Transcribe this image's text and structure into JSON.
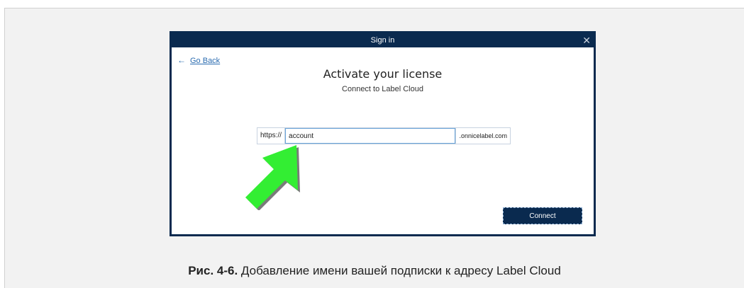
{
  "window": {
    "title": "Sign in",
    "close_glyph": "✕",
    "go_back_label": "Go Back",
    "heading": "Activate your license",
    "subheading": "Connect to Label Cloud",
    "url": {
      "prefix": "https://",
      "value": "account",
      "suffix": ".onnicelabel.com"
    },
    "connect_label": "Connect"
  },
  "caption": {
    "label": "Рис. 4-6.",
    "text": " Добавление имени вашей подписки к адресу Label Cloud"
  },
  "colors": {
    "titlebar": "#0a2a4f",
    "arrow": "#33ee33",
    "link": "#2b6cb0"
  },
  "icons": {
    "back": "arrow-left-icon",
    "close": "close-icon",
    "pointer": "green-arrow-icon"
  }
}
